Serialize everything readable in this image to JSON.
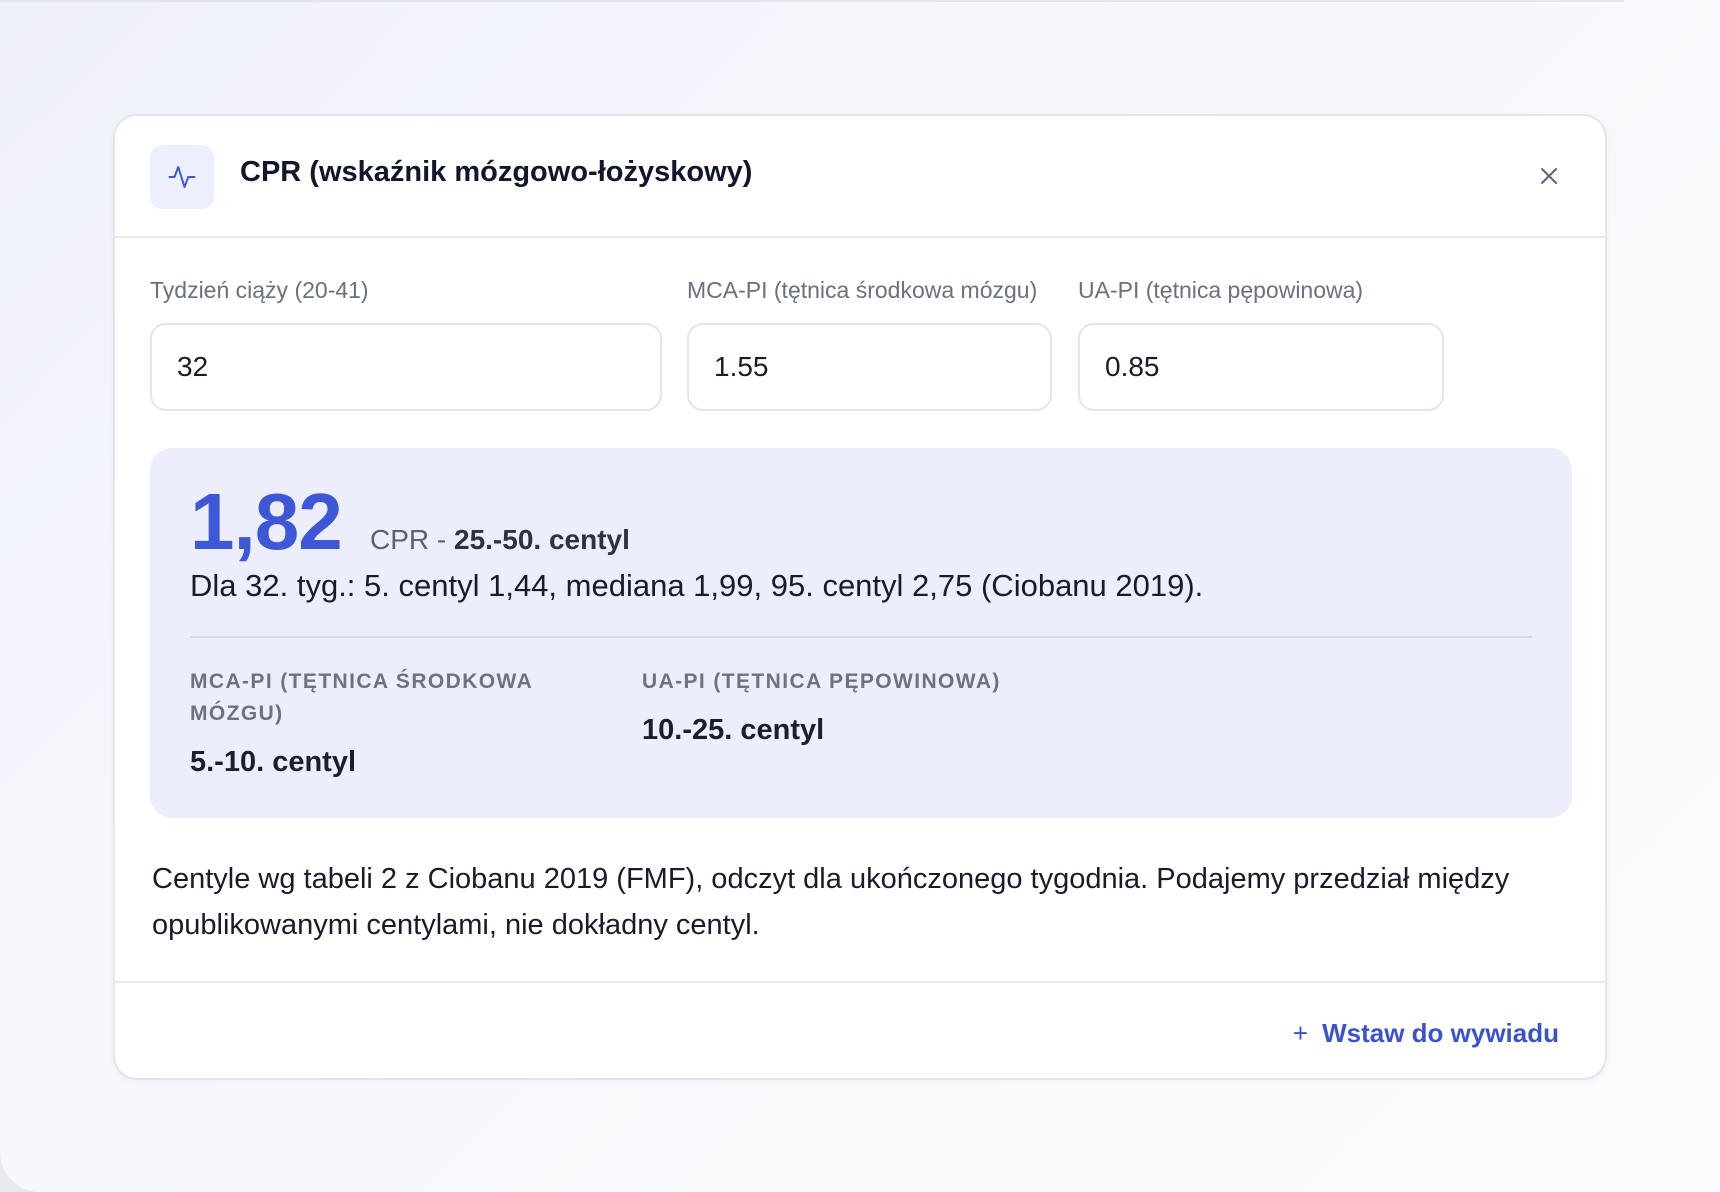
{
  "card": {
    "title": "CPR (wskaźnik mózgowo-łożyskowy)",
    "icon": "activity-pulse-icon",
    "close_icon": "close-icon"
  },
  "fields": {
    "week": {
      "label": "Tydzień ciąży (20-41)",
      "value": "32"
    },
    "mca": {
      "label": "MCA-PI (tętnica środkowa mózgu)",
      "value": "1.55"
    },
    "ua": {
      "label": "UA-PI (tętnica pępowinowa)",
      "value": "0.85"
    }
  },
  "result": {
    "value": "1,82",
    "caption_prefix": "CPR - ",
    "caption_centile": "25.-50. centyl",
    "description": "Dla 32. tyg.: 5. centyl 1,44, mediana 1,99, 95. centyl 2,75 (Ciobanu 2019).",
    "mca": {
      "label": "MCA-PI (tętnica środkowa mózgu)",
      "value": "5.-10. centyl"
    },
    "ua": {
      "label": "UA-PI (tętnica pępowinowa)",
      "value": "10.-25. centyl"
    }
  },
  "footnote": "Centyle wg tabeli 2 z Ciobanu 2019 (FMF), odczyt dla ukończonego tygodnia. Podajemy przedział między opublikowanymi centylami, nie dokładny centyl.",
  "footer": {
    "insert_label": "Wstaw do wywiadu",
    "insert_icon": "plus-icon"
  },
  "colors": {
    "accent": "#3e57d6",
    "result_bg": "#eceefc"
  }
}
